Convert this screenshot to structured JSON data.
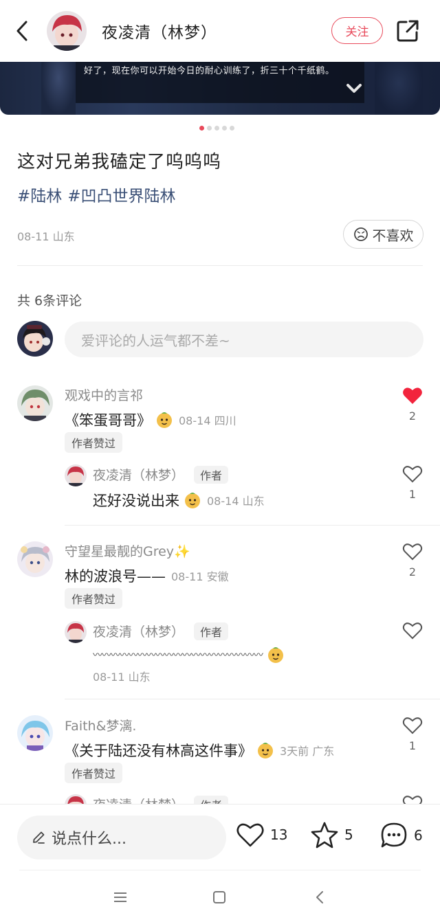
{
  "header": {
    "author_name": "夜凌清（林梦）",
    "follow_label": "关注"
  },
  "banner": {
    "subtitle": "好了，现在你可以开始今日的耐心训练了，折三十个千纸鹤。"
  },
  "post": {
    "title": "这对兄弟我磕定了呜呜呜",
    "tags": [
      "#陆林",
      "#凹凸世界陆林"
    ],
    "meta": "08-11 山东",
    "dislike_label": "不喜欢"
  },
  "comments_header": {
    "count_label": "共 6条评论",
    "input_placeholder": "爱评论的人运气都不差~"
  },
  "comments": [
    {
      "name": "观戏中的言祁",
      "text": "《笨蛋哥哥》",
      "meta": "08-14 四川",
      "liked_by_author": "作者赞过",
      "likes": "2",
      "liked": true,
      "reply": {
        "name": "夜凌清（林梦）",
        "author_tag": "作者",
        "text": "还好没说出来",
        "meta": "08-14 山东",
        "likes": "1"
      }
    },
    {
      "name": "守望星最靓的Grey✨",
      "text": "林的波浪号——",
      "meta": "08-11 安徽",
      "liked_by_author": "作者赞过",
      "likes": "2",
      "liked": false,
      "reply": {
        "name": "夜凌清（林梦）",
        "author_tag": "作者",
        "text": "〰〰〰〰〰〰〰〰〰〰〰〰〰〰〰〰〰〰〰",
        "meta": "08-11 山东",
        "likes": ""
      }
    },
    {
      "name": "Faith&梦漓.",
      "text": "《关于陆还没有林高这件事》",
      "meta": "3天前  广东",
      "liked_by_author": "作者赞过",
      "likes": "1",
      "liked": false,
      "reply": {
        "name": "夜凌清（林梦）",
        "author_tag": "作者"
      }
    }
  ],
  "bottom_bar": {
    "say_placeholder": "说点什么...",
    "like_count": "13",
    "star_count": "5",
    "comment_count": "6"
  },
  "colors": {
    "accent": "#e8495a",
    "tag_blue": "#3a4f76",
    "muted_text": "#9a9a9a"
  }
}
